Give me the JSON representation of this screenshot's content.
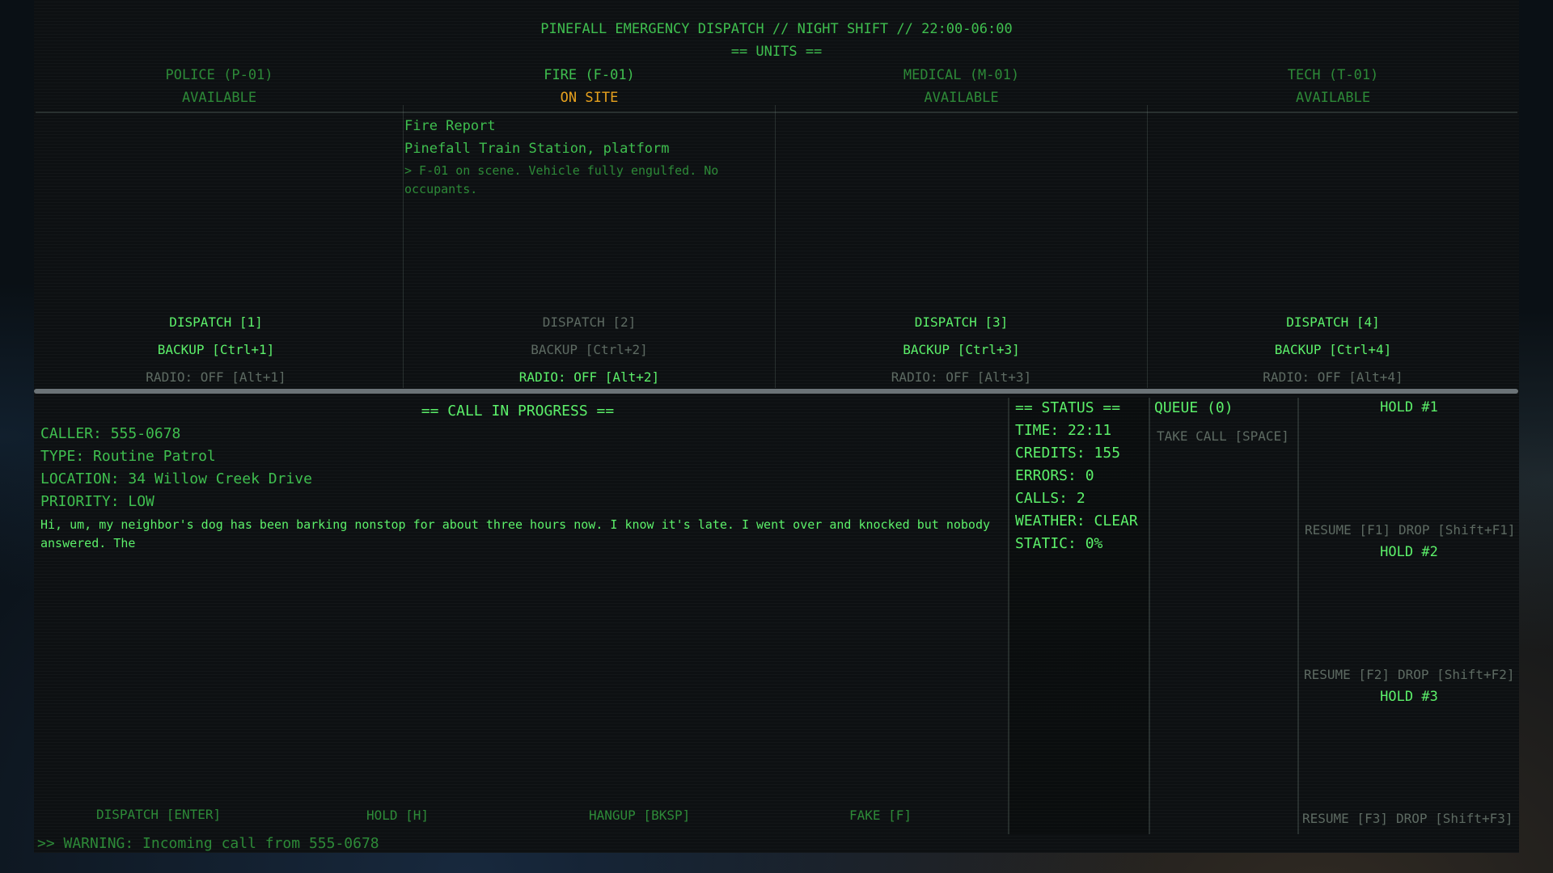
{
  "header": {
    "title": "PINEFALL EMERGENCY DISPATCH // NIGHT SHIFT // 22:00-06:00",
    "units_heading": "== UNITS =="
  },
  "units": [
    {
      "name": "POLICE (P-01)",
      "status": "AVAILABLE",
      "dispatch": "DISPATCH [1]",
      "backup": "BACKUP [Ctrl+1]",
      "radio": "RADIO: OFF [Alt+1]"
    },
    {
      "name": "FIRE (F-01)",
      "status": "ON SITE",
      "dispatch": "DISPATCH [2]",
      "backup": "BACKUP [Ctrl+2]",
      "radio": "RADIO: OFF [Alt+2]",
      "report_title": "Fire Report",
      "report_location": "Pinefall Train Station, platform",
      "report_note": "> F-01 on scene. Vehicle fully engulfed. No occupants."
    },
    {
      "name": "MEDICAL (M-01)",
      "status": "AVAILABLE",
      "dispatch": "DISPATCH [3]",
      "backup": "BACKUP [Ctrl+3]",
      "radio": "RADIO: OFF [Alt+3]"
    },
    {
      "name": "TECH (T-01)",
      "status": "AVAILABLE",
      "dispatch": "DISPATCH [4]",
      "backup": "BACKUP [Ctrl+4]",
      "radio": "RADIO: OFF [Alt+4]"
    }
  ],
  "call": {
    "heading": "== CALL IN PROGRESS ==",
    "caller": "CALLER: 555-0678",
    "type": "TYPE: Routine Patrol",
    "location": "LOCATION: 34 Willow Creek Drive",
    "priority": "PRIORITY: LOW",
    "transcript": "Hi, um, my neighbor's dog has been barking nonstop for about three hours now. I know it's late. I went over and knocked but nobody answered. The",
    "actions": {
      "dispatch": "DISPATCH [ENTER]",
      "hold": "HOLD [H]",
      "hangup": "HANGUP [BKSP]",
      "fake": "FAKE [F]"
    }
  },
  "status": {
    "heading": "== STATUS ==",
    "time": "TIME: 22:11",
    "credits": "CREDITS: 155",
    "errors": "ERRORS: 0",
    "calls": "CALLS: 2",
    "weather": "WEATHER: CLEAR",
    "static": "STATIC: 0%"
  },
  "queue": {
    "heading": "QUEUE (0)",
    "take_call": "TAKE CALL [SPACE]"
  },
  "holds": [
    {
      "title": "HOLD #1",
      "resume": "RESUME [F1]",
      "drop": "DROP [Shift+F1]"
    },
    {
      "title": "HOLD #2",
      "resume": "RESUME [F2]",
      "drop": "DROP [Shift+F2]"
    },
    {
      "title": "HOLD #3",
      "resume": "RESUME [F3]",
      "drop": "DROP [Shift+F3]"
    }
  ],
  "footer": {
    "warning": ">> WARNING: Incoming call from 555-0678"
  },
  "colors": {
    "terminal_green": "#3fbf4f",
    "bright_green": "#5cf06a",
    "on_site_orange": "#e6a11e",
    "disabled_grey": "#5d6a62"
  }
}
